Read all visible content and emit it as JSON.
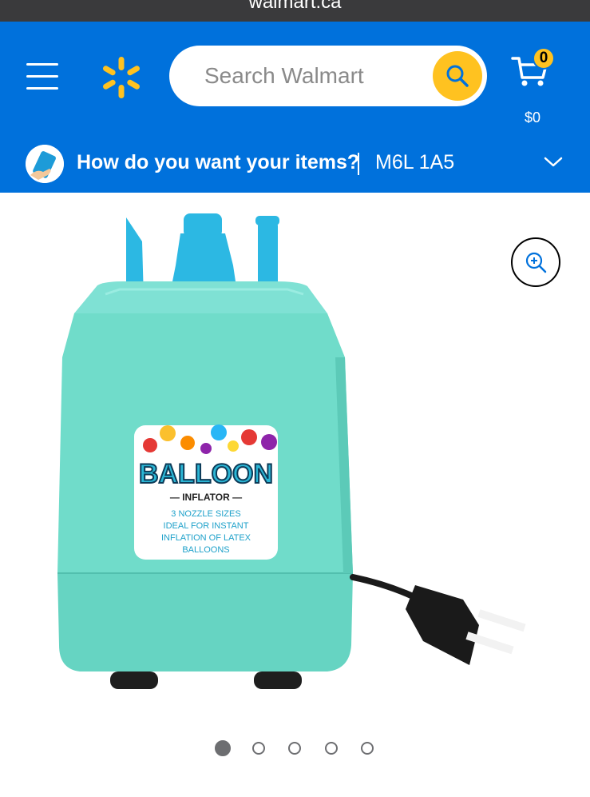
{
  "browser": {
    "url": "walmart.ca"
  },
  "header": {
    "menu_icon": "hamburger-menu-icon",
    "logo_icon": "walmart-spark-icon",
    "search": {
      "placeholder": "Search Walmart",
      "icon": "search-icon"
    },
    "cart": {
      "count": "0",
      "total": "$0",
      "icon": "cart-icon"
    },
    "colors": {
      "brand_blue": "#0071dc",
      "accent_yellow": "#ffc220"
    }
  },
  "delivery": {
    "question": "How do you want your items?",
    "postal_code": "M6L 1A5",
    "icon": "phone-hand-icon",
    "chevron": "chevron-down-icon"
  },
  "product": {
    "zoom_icon": "zoom-in-icon",
    "label": {
      "brand": "BALLOON",
      "subtitle": "— INFLATOR —",
      "lines": [
        "3 NOZZLE SIZES",
        "IDEAL FOR INSTANT",
        "INFLATION OF LATEX",
        "BALLOONS"
      ]
    }
  },
  "carousel": {
    "total": 5,
    "active": 1
  }
}
